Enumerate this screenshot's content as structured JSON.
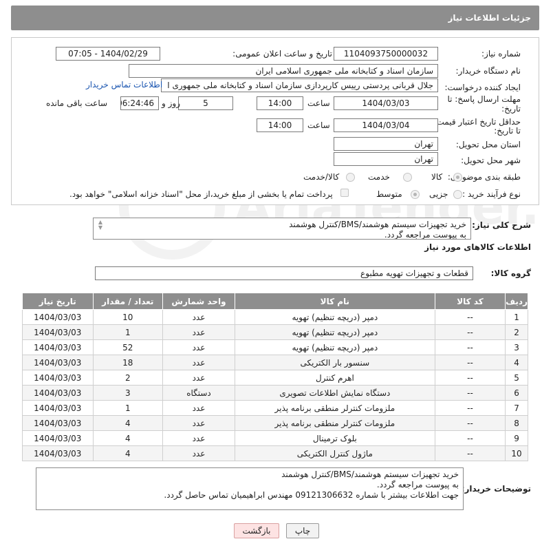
{
  "header": {
    "title": "جزئیات اطلاعات نیاز"
  },
  "form": {
    "need_number_label": "شماره نیاز:",
    "need_number": "1104093750000032",
    "announce_label": "تاریخ و ساعت اعلان عمومی:",
    "announce_value": "1404/02/29 - 07:05",
    "buyer_org_label": "نام دستگاه خریدار:",
    "buyer_org": "سازمان اسناد و کتابخانه ملی جمهوری اسلامی ایران",
    "creator_label": "ایجاد کننده درخواست:",
    "creator": "جلال قربانی پردستی رییس کارپردازی سازمان اسناد و کتابخانه ملی جمهوری ا",
    "contact_link": "اطلاعات تماس خریدار",
    "deadline_label_1": "مهلت ارسال پاسخ: تا",
    "deadline_label_2": "تاریخ:",
    "deadline_date": "1404/03/03",
    "time_word": "ساعت",
    "deadline_time": "14:00",
    "days_value": "5",
    "days_word": "روز و",
    "remaining_time": "06:24:46",
    "remaining_word": "ساعت باقی مانده",
    "validity_label_1": "حداقل تاریخ اعتبار قیمت:",
    "validity_label_2": "تا تاریخ:",
    "validity_date": "1404/03/04",
    "validity_time": "14:00",
    "province_label": "استان محل تحویل:",
    "province": "تهران",
    "city_label": "شهر محل تحویل:",
    "city": "تهران",
    "category_label": "طبقه بندی موضوعی:",
    "category_options": [
      "کالا",
      "خدمت",
      "کالا/خدمت"
    ],
    "process_label": "نوع فرآیند خرید :",
    "process_options": [
      "جزیی",
      "متوسط"
    ],
    "payment_note": "پرداخت تمام یا بخشی از مبلغ خرید،از محل \"اسناد خزانه اسلامی\" خواهد بود."
  },
  "summary": {
    "label": "شرح کلی نیاز:",
    "lines": [
      "خرید تجهیزات سیستم هوشمند/BMS/کنترل هوشمند",
      "به پیوست مراجعه گردد."
    ]
  },
  "goods": {
    "section_title": "اطلاعات کالاهای مورد نیاز",
    "group_label": "گروه کالا:",
    "group_value": "قطعات و تجهیزات تهویه مطبوع"
  },
  "table": {
    "headers": [
      "ردیف",
      "کد کالا",
      "نام کالا",
      "واحد شمارش",
      "تعداد / مقدار",
      "تاریخ نیاز"
    ],
    "rows": [
      [
        "1",
        "--",
        "دمپر (دریچه تنظیم) تهویه",
        "عدد",
        "10",
        "1404/03/03"
      ],
      [
        "2",
        "--",
        "دمپر (دریچه تنظیم) تهویه",
        "عدد",
        "1",
        "1404/03/03"
      ],
      [
        "3",
        "--",
        "دمپر (دریچه تنظیم) تهویه",
        "عدد",
        "52",
        "1404/03/03"
      ],
      [
        "4",
        "--",
        "سنسور بار الکتریکی",
        "عدد",
        "18",
        "1404/03/03"
      ],
      [
        "5",
        "--",
        "اهرم کنترل",
        "عدد",
        "2",
        "1404/03/03"
      ],
      [
        "6",
        "--",
        "دستگاه نمایش اطلاعات تصویری",
        "دستگاه",
        "3",
        "1404/03/03"
      ],
      [
        "7",
        "--",
        "ملزومات کنترلر منطقی برنامه پذیر",
        "عدد",
        "1",
        "1404/03/03"
      ],
      [
        "8",
        "--",
        "ملزومات کنترلر منطقی برنامه پذیر",
        "عدد",
        "4",
        "1404/03/03"
      ],
      [
        "9",
        "--",
        "بلوک ترمینال",
        "عدد",
        "4",
        "1404/03/03"
      ],
      [
        "10",
        "--",
        "ماژول کنترل الکتریکی",
        "عدد",
        "4",
        "1404/03/03"
      ]
    ]
  },
  "buyer_notes": {
    "label": "توضیحات خریدار:",
    "lines": [
      "خرید تجهیزات سیستم هوشمند/BMS/کنترل هوشمند",
      "به پیوست مراجعه گردد.",
      "جهت اطلاعات بیشتر با شماره 09121306632 مهندس ابراهیمیان تماس حاصل گردد."
    ]
  },
  "buttons": {
    "print": "چاپ",
    "back": "بازگشت"
  },
  "watermark_text": "AriaTender.neT"
}
